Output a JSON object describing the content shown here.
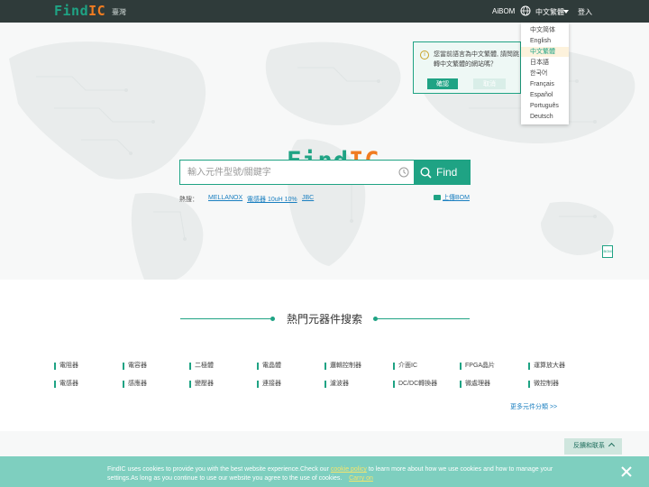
{
  "topbar": {
    "logo_a": "Find",
    "logo_b": "IC",
    "region": "臺灣",
    "aibom": "AiBOM",
    "language": "中文繁體",
    "login": "登入"
  },
  "popup": {
    "message": "您當前語言為中文繁體, 請問跳轉中文繁體的網站嗎？",
    "confirm": "確認",
    "cancel": "取消"
  },
  "languages": [
    {
      "label": "中文简体"
    },
    {
      "label": "English"
    },
    {
      "label": "中文繁體",
      "active": true
    },
    {
      "label": "日本語"
    },
    {
      "label": "한국어"
    },
    {
      "label": "Français"
    },
    {
      "label": "Español"
    },
    {
      "label": "Português"
    },
    {
      "label": "Deutsch"
    }
  ],
  "hero": {
    "logo_a": "Find",
    "logo_b": "IC",
    "search_placeholder": "輸入元件型號/關鍵字",
    "find_label": "Find",
    "hot_label": "熱搜：",
    "hot_links": [
      "MELLANOX",
      "電感器 10uH 10%",
      "JBC"
    ],
    "upload_bom": "上傳BOM",
    "bom_icon_text": "BOM"
  },
  "hot_components": {
    "title": "熱門元器件搜索",
    "row1": [
      "電阻器",
      "電容器",
      "二極體",
      "電晶體",
      "邏輯控制器",
      "介面IC",
      "FPGA晶片",
      "運算放大器"
    ],
    "row2": [
      "電感器",
      "感應器",
      "變壓器",
      "連接器",
      "濾波器",
      "DC/DC轉換器",
      "微處理器",
      "微控制器"
    ],
    "more": "更多元件分類 >>"
  },
  "feedback": "反饋和联系",
  "cookie": {
    "text1": "FindIC uses cookies to provide you with the best website experience.Check our ",
    "policy": "cookie policy",
    "text2": " to learn more about how we use cookies and how to manage your settings.As long as you continue to use our website you agree to the use of cookies.",
    "carry_on": "Carry on"
  },
  "colors": {
    "brand_green": "#1fa384",
    "brand_orange": "#f07c21",
    "topbar": "#2f3b3a",
    "cookie_bar": "#7ecfbf"
  }
}
